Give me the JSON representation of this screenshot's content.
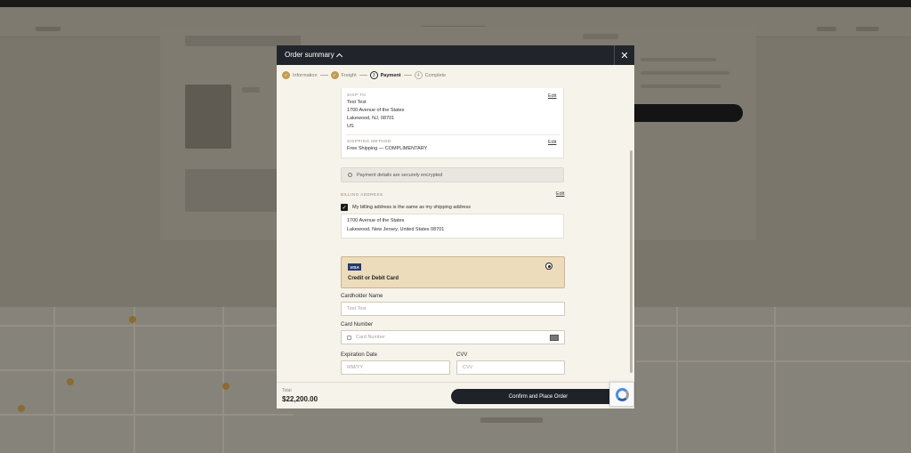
{
  "modal": {
    "title": "Order summary",
    "close_icon": "close-icon",
    "steps": [
      {
        "label": "Information",
        "state": "done",
        "marker": "✓"
      },
      {
        "label": "Freight",
        "state": "done",
        "marker": "✓"
      },
      {
        "label": "Payment",
        "state": "current",
        "marker": "3"
      },
      {
        "label": "Complete",
        "state": "todo",
        "marker": "4"
      }
    ],
    "shipping": {
      "ship_to_label": "SHIP TO",
      "edit_label": "Edit",
      "name": "Test Test",
      "street": "1700 Avenue of the States",
      "city_line": "Lakewood, NJ, 08701",
      "country": "US",
      "method_label": "SHIPPING METHOD",
      "method_edit_label": "Edit",
      "method": "Free Shipping — COMPLIMENTARY"
    },
    "secure_note": "Payment details are securely encrypted",
    "billing": {
      "label": "BILLING ADDRESS",
      "edit_label": "Edit",
      "same_as_shipping_label": "My billing address is the same as my shipping address",
      "same_as_shipping_checked": true,
      "street": "1700 Avenue of the States",
      "city_line": "Lakewood, New Jersey, United States 08701"
    },
    "payment_option": {
      "brand": "VISA",
      "label": "Credit or Debit Card",
      "selected": true
    },
    "form": {
      "cardholder_label": "Cardholder Name",
      "cardholder_value": "Test Test",
      "card_number_label": "Card Number",
      "card_number_placeholder": "Card Number",
      "expiry_label": "Expiration Date",
      "expiry_placeholder": "MM/YY",
      "cvv_label": "CVV",
      "cvv_placeholder": "CVV"
    },
    "footer": {
      "total_label": "Total",
      "total_value": "$22,200.00",
      "confirm_label": "Confirm and Place Order"
    }
  },
  "colors": {
    "modal_header": "#21252b",
    "accent_gold": "#c39a53",
    "payment_option_bg": "#ecdcbc",
    "confirm_button": "#1f2329"
  }
}
